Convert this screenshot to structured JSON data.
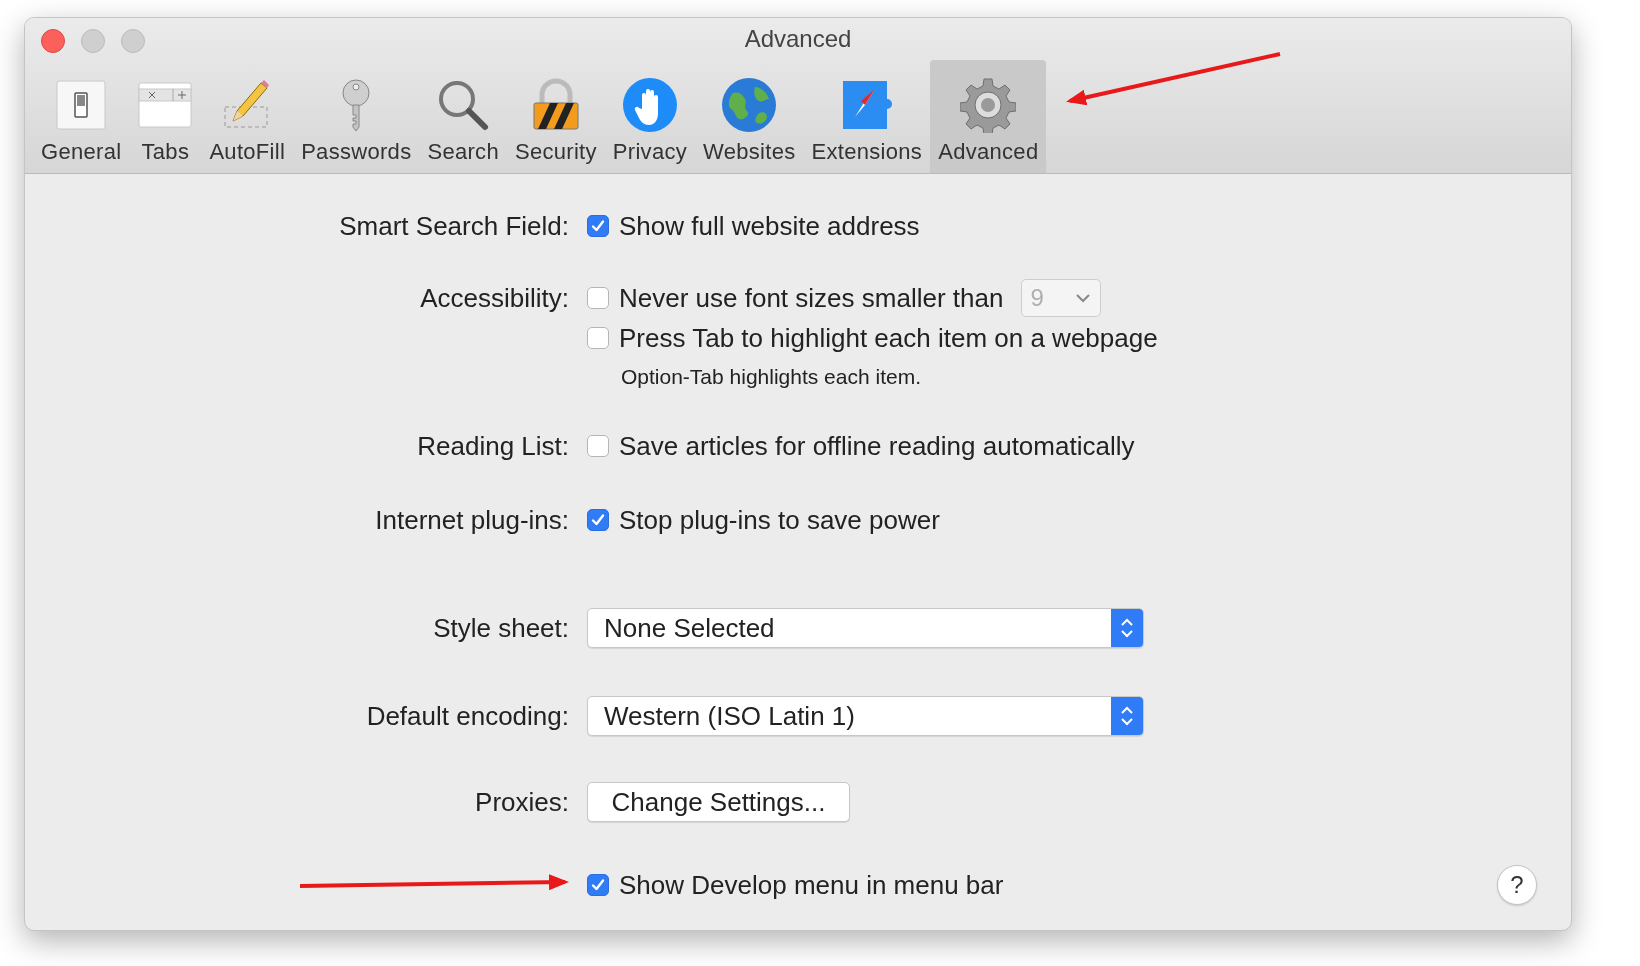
{
  "window": {
    "title": "Advanced"
  },
  "toolbar": [
    {
      "label": "General",
      "selected": false
    },
    {
      "label": "Tabs",
      "selected": false
    },
    {
      "label": "AutoFill",
      "selected": false
    },
    {
      "label": "Passwords",
      "selected": false
    },
    {
      "label": "Search",
      "selected": false
    },
    {
      "label": "Security",
      "selected": false
    },
    {
      "label": "Privacy",
      "selected": false
    },
    {
      "label": "Websites",
      "selected": false
    },
    {
      "label": "Extensions",
      "selected": false
    },
    {
      "label": "Advanced",
      "selected": true
    }
  ],
  "settings": [
    {
      "kind": "checks",
      "label": "Smart Search Field:",
      "options": [
        {
          "text": "Show full website address",
          "checked": true
        }
      ]
    },
    {
      "kind": "checks",
      "label": "Accessibility:",
      "options": [
        {
          "text": "Never use font sizes smaller than",
          "checked": false,
          "select": {
            "value": "9",
            "disabled": true
          }
        },
        {
          "text": "Press Tab to highlight each item on a webpage",
          "checked": false,
          "note": "Option-Tab highlights each item."
        }
      ]
    },
    {
      "kind": "checks",
      "label": "Reading List:",
      "options": [
        {
          "text": "Save articles for offline reading automatically",
          "checked": false
        }
      ]
    },
    {
      "kind": "checks",
      "label": "Internet plug-ins:",
      "options": [
        {
          "text": "Stop plug-ins to save power",
          "checked": true
        }
      ]
    },
    {
      "kind": "popup",
      "label": "Style sheet:",
      "value": "None Selected"
    },
    {
      "kind": "popup",
      "label": "Default encoding:",
      "value": "Western (ISO Latin 1)"
    },
    {
      "kind": "button",
      "label": "Proxies:",
      "value": "Change Settings..."
    },
    {
      "kind": "checks",
      "options": [
        {
          "text": "Show Develop menu in menu bar",
          "checked": true
        }
      ]
    }
  ],
  "help": "?"
}
